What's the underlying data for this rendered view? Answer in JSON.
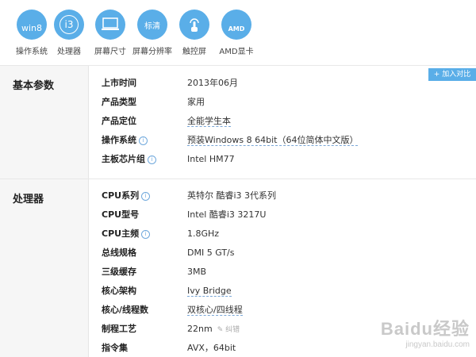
{
  "icons": [
    {
      "name": "win8-icon",
      "glyph": "win8",
      "label": "操作系统"
    },
    {
      "name": "cpu-i3-icon",
      "glyph": "i3",
      "label": "处理器"
    },
    {
      "name": "screen-size-icon",
      "glyph": "▭",
      "label": "屏幕尺寸"
    },
    {
      "name": "resolution-icon",
      "glyph": "标清",
      "label": "屏幕分辨率"
    },
    {
      "name": "touchscreen-icon",
      "glyph": "☝",
      "label": "触控屏"
    },
    {
      "name": "amd-gpu-icon",
      "glyph": "AMD",
      "label": "AMD显卡"
    }
  ],
  "compare_button": "+ 加入对比",
  "sections": {
    "basic": {
      "title": "基本参数",
      "rows": [
        {
          "k": "上市时间",
          "v": "2013年06月"
        },
        {
          "k": "产品类型",
          "v": "家用"
        },
        {
          "k": "产品定位",
          "v": "全能学生本"
        },
        {
          "k": "操作系统",
          "v": "预装Windows 8 64bit（64位简体中文版）"
        },
        {
          "k": "主板芯片组",
          "v": "Intel HM77"
        }
      ]
    },
    "cpu": {
      "title": "处理器",
      "rows": [
        {
          "k": "CPU系列",
          "v": "英特尔 酷睿i3 3代系列"
        },
        {
          "k": "CPU型号",
          "v": "Intel 酷睿i3 3217U"
        },
        {
          "k": "CPU主频",
          "v": "1.8GHz"
        },
        {
          "k": "总线规格",
          "v": "DMI 5 GT/s"
        },
        {
          "k": "三级缓存",
          "v": "3MB"
        },
        {
          "k": "核心架构",
          "v": "Ivy Bridge"
        },
        {
          "k": "核心/线程数",
          "v": "双核心/四线程"
        },
        {
          "k": "制程工艺",
          "v": "22nm"
        },
        {
          "k": "指令集",
          "v": "AVX，64bit"
        }
      ]
    }
  },
  "correction_label": "纠错",
  "watermark": {
    "line1": "Baidu经验",
    "line2": "jingyan.baidu.com"
  }
}
